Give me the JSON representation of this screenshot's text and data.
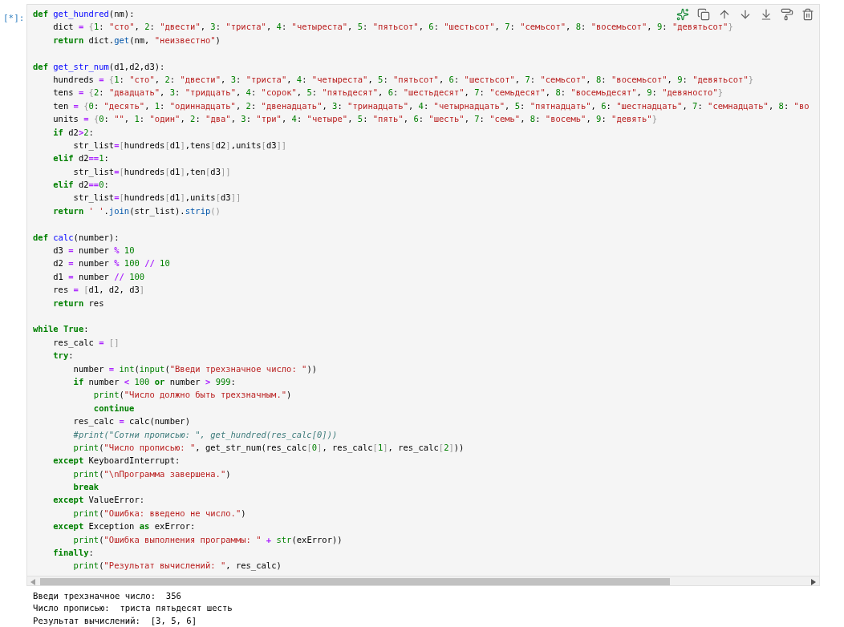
{
  "cell": {
    "prompt": "[*]:",
    "code_lines": [
      {
        "kind": "code",
        "tokens": [
          {
            "kind": "kw",
            "text": "def "
          },
          {
            "kind": "def",
            "text": "get_hundred"
          },
          {
            "kind": "plain",
            "text": "(nm):"
          }
        ]
      },
      {
        "kind": "code",
        "tokens": [
          {
            "kind": "plain",
            "text": "    dict "
          },
          {
            "kind": "op",
            "text": "= "
          },
          {
            "kind": "bracket",
            "text": "{"
          },
          {
            "kind": "num",
            "text": "1"
          },
          {
            "kind": "plain",
            "text": ": "
          },
          {
            "kind": "str",
            "text": "\"сто\""
          },
          {
            "kind": "plain",
            "text": ", "
          },
          {
            "kind": "num",
            "text": "2"
          },
          {
            "kind": "plain",
            "text": ": "
          },
          {
            "kind": "str",
            "text": "\"двести\""
          },
          {
            "kind": "plain",
            "text": ", "
          },
          {
            "kind": "num",
            "text": "3"
          },
          {
            "kind": "plain",
            "text": ": "
          },
          {
            "kind": "str",
            "text": "\"триста\""
          },
          {
            "kind": "plain",
            "text": ", "
          },
          {
            "kind": "num",
            "text": "4"
          },
          {
            "kind": "plain",
            "text": ": "
          },
          {
            "kind": "str",
            "text": "\"четыреста\""
          },
          {
            "kind": "plain",
            "text": ", "
          },
          {
            "kind": "num",
            "text": "5"
          },
          {
            "kind": "plain",
            "text": ": "
          },
          {
            "kind": "str",
            "text": "\"пятьсот\""
          },
          {
            "kind": "plain",
            "text": ", "
          },
          {
            "kind": "num",
            "text": "6"
          },
          {
            "kind": "plain",
            "text": ": "
          },
          {
            "kind": "str",
            "text": "\"шестьсот\""
          },
          {
            "kind": "plain",
            "text": ", "
          },
          {
            "kind": "num",
            "text": "7"
          },
          {
            "kind": "plain",
            "text": ": "
          },
          {
            "kind": "str",
            "text": "\"семьсот\""
          },
          {
            "kind": "plain",
            "text": ", "
          },
          {
            "kind": "num",
            "text": "8"
          },
          {
            "kind": "plain",
            "text": ": "
          },
          {
            "kind": "str",
            "text": "\"восемьсот\""
          },
          {
            "kind": "plain",
            "text": ", "
          },
          {
            "kind": "num",
            "text": "9"
          },
          {
            "kind": "plain",
            "text": ": "
          },
          {
            "kind": "str",
            "text": "\"девятьсот\""
          },
          {
            "kind": "bracket",
            "text": "}"
          }
        ]
      },
      {
        "kind": "code",
        "tokens": [
          {
            "kind": "kw",
            "text": "    return"
          },
          {
            "kind": "plain",
            "text": " dict."
          },
          {
            "kind": "prop",
            "text": "get"
          },
          {
            "kind": "plain",
            "text": "(nm, "
          },
          {
            "kind": "str",
            "text": "\"неизвестно\""
          },
          {
            "kind": "plain",
            "text": ")"
          }
        ]
      },
      {
        "kind": "blank"
      },
      {
        "kind": "code",
        "tokens": [
          {
            "kind": "kw",
            "text": "def "
          },
          {
            "kind": "def",
            "text": "get_str_num"
          },
          {
            "kind": "plain",
            "text": "(d1,d2,d3):"
          }
        ]
      },
      {
        "kind": "code",
        "tokens": [
          {
            "kind": "plain",
            "text": "    hundreds "
          },
          {
            "kind": "op",
            "text": "= "
          },
          {
            "kind": "bracket",
            "text": "{"
          },
          {
            "kind": "num",
            "text": "1"
          },
          {
            "kind": "plain",
            "text": ": "
          },
          {
            "kind": "str",
            "text": "\"сто\""
          },
          {
            "kind": "plain",
            "text": ", "
          },
          {
            "kind": "num",
            "text": "2"
          },
          {
            "kind": "plain",
            "text": ": "
          },
          {
            "kind": "str",
            "text": "\"двести\""
          },
          {
            "kind": "plain",
            "text": ", "
          },
          {
            "kind": "num",
            "text": "3"
          },
          {
            "kind": "plain",
            "text": ": "
          },
          {
            "kind": "str",
            "text": "\"триста\""
          },
          {
            "kind": "plain",
            "text": ", "
          },
          {
            "kind": "num",
            "text": "4"
          },
          {
            "kind": "plain",
            "text": ": "
          },
          {
            "kind": "str",
            "text": "\"четыреста\""
          },
          {
            "kind": "plain",
            "text": ", "
          },
          {
            "kind": "num",
            "text": "5"
          },
          {
            "kind": "plain",
            "text": ": "
          },
          {
            "kind": "str",
            "text": "\"пятьсот\""
          },
          {
            "kind": "plain",
            "text": ", "
          },
          {
            "kind": "num",
            "text": "6"
          },
          {
            "kind": "plain",
            "text": ": "
          },
          {
            "kind": "str",
            "text": "\"шестьсот\""
          },
          {
            "kind": "plain",
            "text": ", "
          },
          {
            "kind": "num",
            "text": "7"
          },
          {
            "kind": "plain",
            "text": ": "
          },
          {
            "kind": "str",
            "text": "\"семьсот\""
          },
          {
            "kind": "plain",
            "text": ", "
          },
          {
            "kind": "num",
            "text": "8"
          },
          {
            "kind": "plain",
            "text": ": "
          },
          {
            "kind": "str",
            "text": "\"восемьсот\""
          },
          {
            "kind": "plain",
            "text": ", "
          },
          {
            "kind": "num",
            "text": "9"
          },
          {
            "kind": "plain",
            "text": ": "
          },
          {
            "kind": "str",
            "text": "\"девятьсот\""
          },
          {
            "kind": "bracket",
            "text": "}"
          }
        ]
      },
      {
        "kind": "code",
        "tokens": [
          {
            "kind": "plain",
            "text": "    tens "
          },
          {
            "kind": "op",
            "text": "= "
          },
          {
            "kind": "bracket",
            "text": "{"
          },
          {
            "kind": "num",
            "text": "2"
          },
          {
            "kind": "plain",
            "text": ": "
          },
          {
            "kind": "str",
            "text": "\"двадцать\""
          },
          {
            "kind": "plain",
            "text": ", "
          },
          {
            "kind": "num",
            "text": "3"
          },
          {
            "kind": "plain",
            "text": ": "
          },
          {
            "kind": "str",
            "text": "\"тридцать\""
          },
          {
            "kind": "plain",
            "text": ", "
          },
          {
            "kind": "num",
            "text": "4"
          },
          {
            "kind": "plain",
            "text": ": "
          },
          {
            "kind": "str",
            "text": "\"сорок\""
          },
          {
            "kind": "plain",
            "text": ", "
          },
          {
            "kind": "num",
            "text": "5"
          },
          {
            "kind": "plain",
            "text": ": "
          },
          {
            "kind": "str",
            "text": "\"пятьдесят\""
          },
          {
            "kind": "plain",
            "text": ", "
          },
          {
            "kind": "num",
            "text": "6"
          },
          {
            "kind": "plain",
            "text": ": "
          },
          {
            "kind": "str",
            "text": "\"шестьдесят\""
          },
          {
            "kind": "plain",
            "text": ", "
          },
          {
            "kind": "num",
            "text": "7"
          },
          {
            "kind": "plain",
            "text": ": "
          },
          {
            "kind": "str",
            "text": "\"семьдесят\""
          },
          {
            "kind": "plain",
            "text": ", "
          },
          {
            "kind": "num",
            "text": "8"
          },
          {
            "kind": "plain",
            "text": ": "
          },
          {
            "kind": "str",
            "text": "\"восемьдесят\""
          },
          {
            "kind": "plain",
            "text": ", "
          },
          {
            "kind": "num",
            "text": "9"
          },
          {
            "kind": "plain",
            "text": ": "
          },
          {
            "kind": "str",
            "text": "\"девяносто\""
          },
          {
            "kind": "bracket",
            "text": "}"
          }
        ]
      },
      {
        "kind": "code",
        "tokens": [
          {
            "kind": "plain",
            "text": "    ten "
          },
          {
            "kind": "op",
            "text": "= "
          },
          {
            "kind": "bracket",
            "text": "{"
          },
          {
            "kind": "num",
            "text": "0"
          },
          {
            "kind": "plain",
            "text": ": "
          },
          {
            "kind": "str",
            "text": "\"десять\""
          },
          {
            "kind": "plain",
            "text": ", "
          },
          {
            "kind": "num",
            "text": "1"
          },
          {
            "kind": "plain",
            "text": ": "
          },
          {
            "kind": "str",
            "text": "\"одиннадцать\""
          },
          {
            "kind": "plain",
            "text": ", "
          },
          {
            "kind": "num",
            "text": "2"
          },
          {
            "kind": "plain",
            "text": ": "
          },
          {
            "kind": "str",
            "text": "\"двенадцать\""
          },
          {
            "kind": "plain",
            "text": ", "
          },
          {
            "kind": "num",
            "text": "3"
          },
          {
            "kind": "plain",
            "text": ": "
          },
          {
            "kind": "str",
            "text": "\"тринадцать\""
          },
          {
            "kind": "plain",
            "text": ", "
          },
          {
            "kind": "num",
            "text": "4"
          },
          {
            "kind": "plain",
            "text": ": "
          },
          {
            "kind": "str",
            "text": "\"четырнадцать\""
          },
          {
            "kind": "plain",
            "text": ", "
          },
          {
            "kind": "num",
            "text": "5"
          },
          {
            "kind": "plain",
            "text": ": "
          },
          {
            "kind": "str",
            "text": "\"пятнадцать\""
          },
          {
            "kind": "plain",
            "text": ", "
          },
          {
            "kind": "num",
            "text": "6"
          },
          {
            "kind": "plain",
            "text": ": "
          },
          {
            "kind": "str",
            "text": "\"шестнадцать\""
          },
          {
            "kind": "plain",
            "text": ", "
          },
          {
            "kind": "num",
            "text": "7"
          },
          {
            "kind": "plain",
            "text": ": "
          },
          {
            "kind": "str",
            "text": "\"семнадцать\""
          },
          {
            "kind": "plain",
            "text": ", "
          },
          {
            "kind": "num",
            "text": "8"
          },
          {
            "kind": "plain",
            "text": ": "
          },
          {
            "kind": "str",
            "text": "\"во"
          }
        ]
      },
      {
        "kind": "code",
        "tokens": [
          {
            "kind": "plain",
            "text": "    units "
          },
          {
            "kind": "op",
            "text": "= "
          },
          {
            "kind": "bracket",
            "text": "{"
          },
          {
            "kind": "num",
            "text": "0"
          },
          {
            "kind": "plain",
            "text": ": "
          },
          {
            "kind": "str",
            "text": "\"\""
          },
          {
            "kind": "plain",
            "text": ", "
          },
          {
            "kind": "num",
            "text": "1"
          },
          {
            "kind": "plain",
            "text": ": "
          },
          {
            "kind": "str",
            "text": "\"один\""
          },
          {
            "kind": "plain",
            "text": ", "
          },
          {
            "kind": "num",
            "text": "2"
          },
          {
            "kind": "plain",
            "text": ": "
          },
          {
            "kind": "str",
            "text": "\"два\""
          },
          {
            "kind": "plain",
            "text": ", "
          },
          {
            "kind": "num",
            "text": "3"
          },
          {
            "kind": "plain",
            "text": ": "
          },
          {
            "kind": "str",
            "text": "\"три\""
          },
          {
            "kind": "plain",
            "text": ", "
          },
          {
            "kind": "num",
            "text": "4"
          },
          {
            "kind": "plain",
            "text": ": "
          },
          {
            "kind": "str",
            "text": "\"четыре\""
          },
          {
            "kind": "plain",
            "text": ", "
          },
          {
            "kind": "num",
            "text": "5"
          },
          {
            "kind": "plain",
            "text": ": "
          },
          {
            "kind": "str",
            "text": "\"пять\""
          },
          {
            "kind": "plain",
            "text": ", "
          },
          {
            "kind": "num",
            "text": "6"
          },
          {
            "kind": "plain",
            "text": ": "
          },
          {
            "kind": "str",
            "text": "\"шесть\""
          },
          {
            "kind": "plain",
            "text": ", "
          },
          {
            "kind": "num",
            "text": "7"
          },
          {
            "kind": "plain",
            "text": ": "
          },
          {
            "kind": "str",
            "text": "\"семь\""
          },
          {
            "kind": "plain",
            "text": ", "
          },
          {
            "kind": "num",
            "text": "8"
          },
          {
            "kind": "plain",
            "text": ": "
          },
          {
            "kind": "str",
            "text": "\"восемь\""
          },
          {
            "kind": "plain",
            "text": ", "
          },
          {
            "kind": "num",
            "text": "9"
          },
          {
            "kind": "plain",
            "text": ": "
          },
          {
            "kind": "str",
            "text": "\"девять\""
          },
          {
            "kind": "bracket",
            "text": "}"
          }
        ]
      },
      {
        "kind": "code",
        "tokens": [
          {
            "kind": "kw",
            "text": "    if"
          },
          {
            "kind": "plain",
            "text": " d2"
          },
          {
            "kind": "op",
            "text": ">"
          },
          {
            "kind": "num",
            "text": "2"
          },
          {
            "kind": "plain",
            "text": ":"
          }
        ]
      },
      {
        "kind": "code",
        "tokens": [
          {
            "kind": "plain",
            "text": "        str_list"
          },
          {
            "kind": "op",
            "text": "="
          },
          {
            "kind": "bracket",
            "text": "["
          },
          {
            "kind": "plain",
            "text": "hundreds"
          },
          {
            "kind": "bracket",
            "text": "["
          },
          {
            "kind": "plain",
            "text": "d1"
          },
          {
            "kind": "bracket",
            "text": "]"
          },
          {
            "kind": "plain",
            "text": ",tens"
          },
          {
            "kind": "bracket",
            "text": "["
          },
          {
            "kind": "plain",
            "text": "d2"
          },
          {
            "kind": "bracket",
            "text": "]"
          },
          {
            "kind": "plain",
            "text": ",units"
          },
          {
            "kind": "bracket",
            "text": "["
          },
          {
            "kind": "plain",
            "text": "d3"
          },
          {
            "kind": "bracket",
            "text": "]]"
          }
        ]
      },
      {
        "kind": "code",
        "tokens": [
          {
            "kind": "kw",
            "text": "    elif"
          },
          {
            "kind": "plain",
            "text": " d2"
          },
          {
            "kind": "op",
            "text": "=="
          },
          {
            "kind": "num",
            "text": "1"
          },
          {
            "kind": "plain",
            "text": ":"
          }
        ]
      },
      {
        "kind": "code",
        "tokens": [
          {
            "kind": "plain",
            "text": "        str_list"
          },
          {
            "kind": "op",
            "text": "="
          },
          {
            "kind": "bracket",
            "text": "["
          },
          {
            "kind": "plain",
            "text": "hundreds"
          },
          {
            "kind": "bracket",
            "text": "["
          },
          {
            "kind": "plain",
            "text": "d1"
          },
          {
            "kind": "bracket",
            "text": "]"
          },
          {
            "kind": "plain",
            "text": ",ten"
          },
          {
            "kind": "bracket",
            "text": "["
          },
          {
            "kind": "plain",
            "text": "d3"
          },
          {
            "kind": "bracket",
            "text": "]]"
          }
        ]
      },
      {
        "kind": "code",
        "tokens": [
          {
            "kind": "kw",
            "text": "    elif"
          },
          {
            "kind": "plain",
            "text": " d2"
          },
          {
            "kind": "op",
            "text": "=="
          },
          {
            "kind": "num",
            "text": "0"
          },
          {
            "kind": "plain",
            "text": ":"
          }
        ]
      },
      {
        "kind": "code",
        "tokens": [
          {
            "kind": "plain",
            "text": "        str_list"
          },
          {
            "kind": "op",
            "text": "="
          },
          {
            "kind": "bracket",
            "text": "["
          },
          {
            "kind": "plain",
            "text": "hundreds"
          },
          {
            "kind": "bracket",
            "text": "["
          },
          {
            "kind": "plain",
            "text": "d1"
          },
          {
            "kind": "bracket",
            "text": "]"
          },
          {
            "kind": "plain",
            "text": ",units"
          },
          {
            "kind": "bracket",
            "text": "["
          },
          {
            "kind": "plain",
            "text": "d3"
          },
          {
            "kind": "bracket",
            "text": "]]"
          }
        ]
      },
      {
        "kind": "code",
        "tokens": [
          {
            "kind": "kw",
            "text": "    return "
          },
          {
            "kind": "str",
            "text": "' '"
          },
          {
            "kind": "plain",
            "text": "."
          },
          {
            "kind": "prop",
            "text": "join"
          },
          {
            "kind": "plain",
            "text": "(str_list)."
          },
          {
            "kind": "prop",
            "text": "strip"
          },
          {
            "kind": "bracket",
            "text": "()"
          }
        ]
      },
      {
        "kind": "blank"
      },
      {
        "kind": "code",
        "tokens": [
          {
            "kind": "kw",
            "text": "def "
          },
          {
            "kind": "def",
            "text": "calc"
          },
          {
            "kind": "plain",
            "text": "(number):"
          }
        ]
      },
      {
        "kind": "code",
        "tokens": [
          {
            "kind": "plain",
            "text": "    d3 "
          },
          {
            "kind": "op",
            "text": "="
          },
          {
            "kind": "plain",
            "text": " number "
          },
          {
            "kind": "op",
            "text": "% "
          },
          {
            "kind": "num",
            "text": "10"
          }
        ]
      },
      {
        "kind": "code",
        "tokens": [
          {
            "kind": "plain",
            "text": "    d2 "
          },
          {
            "kind": "op",
            "text": "="
          },
          {
            "kind": "plain",
            "text": " number "
          },
          {
            "kind": "op",
            "text": "% "
          },
          {
            "kind": "num",
            "text": "100 "
          },
          {
            "kind": "op",
            "text": "// "
          },
          {
            "kind": "num",
            "text": "10"
          }
        ]
      },
      {
        "kind": "code",
        "tokens": [
          {
            "kind": "plain",
            "text": "    d1 "
          },
          {
            "kind": "op",
            "text": "="
          },
          {
            "kind": "plain",
            "text": " number "
          },
          {
            "kind": "op",
            "text": "// "
          },
          {
            "kind": "num",
            "text": "100"
          }
        ]
      },
      {
        "kind": "code",
        "tokens": [
          {
            "kind": "plain",
            "text": "    res "
          },
          {
            "kind": "op",
            "text": "= "
          },
          {
            "kind": "bracket",
            "text": "["
          },
          {
            "kind": "plain",
            "text": "d1, d2, d3"
          },
          {
            "kind": "bracket",
            "text": "]"
          }
        ]
      },
      {
        "kind": "code",
        "tokens": [
          {
            "kind": "kw",
            "text": "    return"
          },
          {
            "kind": "plain",
            "text": " res"
          }
        ]
      },
      {
        "kind": "blank"
      },
      {
        "kind": "code",
        "tokens": [
          {
            "kind": "kw",
            "text": "while True"
          },
          {
            "kind": "plain",
            "text": ":"
          }
        ]
      },
      {
        "kind": "code",
        "tokens": [
          {
            "kind": "plain",
            "text": "    res_calc "
          },
          {
            "kind": "op",
            "text": "= "
          },
          {
            "kind": "bracket",
            "text": "[]"
          }
        ]
      },
      {
        "kind": "code",
        "tokens": [
          {
            "kind": "kw",
            "text": "    try"
          },
          {
            "kind": "plain",
            "text": ":"
          }
        ]
      },
      {
        "kind": "code",
        "tokens": [
          {
            "kind": "plain",
            "text": "        number "
          },
          {
            "kind": "op",
            "text": "= "
          },
          {
            "kind": "builtin",
            "text": "int"
          },
          {
            "kind": "plain",
            "text": "("
          },
          {
            "kind": "builtin",
            "text": "input"
          },
          {
            "kind": "plain",
            "text": "("
          },
          {
            "kind": "str",
            "text": "\"Введи трехзначное число: \""
          },
          {
            "kind": "plain",
            "text": "))"
          }
        ]
      },
      {
        "kind": "code",
        "tokens": [
          {
            "kind": "kw",
            "text": "        if"
          },
          {
            "kind": "plain",
            "text": " number "
          },
          {
            "kind": "op",
            "text": "< "
          },
          {
            "kind": "num",
            "text": "100 "
          },
          {
            "kind": "kw",
            "text": "or"
          },
          {
            "kind": "plain",
            "text": " number "
          },
          {
            "kind": "op",
            "text": "> "
          },
          {
            "kind": "num",
            "text": "999"
          },
          {
            "kind": "plain",
            "text": ":"
          }
        ]
      },
      {
        "kind": "code",
        "tokens": [
          {
            "kind": "builtin",
            "text": "            print"
          },
          {
            "kind": "plain",
            "text": "("
          },
          {
            "kind": "str",
            "text": "\"Число должно быть трехзначным.\""
          },
          {
            "kind": "plain",
            "text": ")"
          }
        ]
      },
      {
        "kind": "code",
        "tokens": [
          {
            "kind": "kw",
            "text": "            continue"
          }
        ]
      },
      {
        "kind": "code",
        "tokens": [
          {
            "kind": "plain",
            "text": "        res_calc "
          },
          {
            "kind": "op",
            "text": "="
          },
          {
            "kind": "plain",
            "text": " calc(number)"
          }
        ]
      },
      {
        "kind": "code",
        "tokens": [
          {
            "kind": "comment",
            "text": "        #print(\"Сотни прописью: \", get_hundred(res_calc[0]))"
          }
        ]
      },
      {
        "kind": "code",
        "tokens": [
          {
            "kind": "builtin",
            "text": "        print"
          },
          {
            "kind": "plain",
            "text": "("
          },
          {
            "kind": "str",
            "text": "\"Число прописью: \""
          },
          {
            "kind": "plain",
            "text": ", get_str_num(res_calc"
          },
          {
            "kind": "bracket",
            "text": "["
          },
          {
            "kind": "num",
            "text": "0"
          },
          {
            "kind": "bracket",
            "text": "]"
          },
          {
            "kind": "plain",
            "text": ", res_calc"
          },
          {
            "kind": "bracket",
            "text": "["
          },
          {
            "kind": "num",
            "text": "1"
          },
          {
            "kind": "bracket",
            "text": "]"
          },
          {
            "kind": "plain",
            "text": ", res_calc"
          },
          {
            "kind": "bracket",
            "text": "["
          },
          {
            "kind": "num",
            "text": "2"
          },
          {
            "kind": "bracket",
            "text": "]"
          },
          {
            "kind": "plain",
            "text": "))"
          }
        ]
      },
      {
        "kind": "code",
        "tokens": [
          {
            "kind": "kw",
            "text": "    except"
          },
          {
            "kind": "plain",
            "text": " KeyboardInterrupt:"
          }
        ]
      },
      {
        "kind": "code",
        "tokens": [
          {
            "kind": "builtin",
            "text": "        print"
          },
          {
            "kind": "plain",
            "text": "("
          },
          {
            "kind": "str",
            "text": "\"\\nПрограмма завершена.\""
          },
          {
            "kind": "plain",
            "text": ")"
          }
        ]
      },
      {
        "kind": "code",
        "tokens": [
          {
            "kind": "kw",
            "text": "        break"
          }
        ]
      },
      {
        "kind": "code",
        "tokens": [
          {
            "kind": "kw",
            "text": "    except"
          },
          {
            "kind": "plain",
            "text": " ValueError:"
          }
        ]
      },
      {
        "kind": "code",
        "tokens": [
          {
            "kind": "builtin",
            "text": "        print"
          },
          {
            "kind": "plain",
            "text": "("
          },
          {
            "kind": "str",
            "text": "\"Ошибка: введено не число.\""
          },
          {
            "kind": "plain",
            "text": ")"
          }
        ]
      },
      {
        "kind": "code",
        "tokens": [
          {
            "kind": "kw",
            "text": "    except"
          },
          {
            "kind": "plain",
            "text": " Exception "
          },
          {
            "kind": "kw",
            "text": "as"
          },
          {
            "kind": "plain",
            "text": " exError:"
          }
        ]
      },
      {
        "kind": "code",
        "tokens": [
          {
            "kind": "builtin",
            "text": "        print"
          },
          {
            "kind": "plain",
            "text": "("
          },
          {
            "kind": "str",
            "text": "\"Ошибка выполнения программы: \""
          },
          {
            "kind": "op",
            "text": " + "
          },
          {
            "kind": "builtin",
            "text": "str"
          },
          {
            "kind": "plain",
            "text": "(exError))"
          }
        ]
      },
      {
        "kind": "code",
        "tokens": [
          {
            "kind": "kw",
            "text": "    finally"
          },
          {
            "kind": "plain",
            "text": ":"
          }
        ]
      },
      {
        "kind": "code",
        "tokens": [
          {
            "kind": "builtin",
            "text": "        print"
          },
          {
            "kind": "plain",
            "text": "("
          },
          {
            "kind": "str",
            "text": "\"Результат вычислений: \""
          },
          {
            "kind": "plain",
            "text": ", res_calc)"
          }
        ]
      }
    ],
    "output_lines": [
      "Введи трехзначное число:  356",
      "Число прописью:  триста пятьдесят шесть",
      "Результат вычислений:  [3, 5, 6]"
    ]
  }
}
